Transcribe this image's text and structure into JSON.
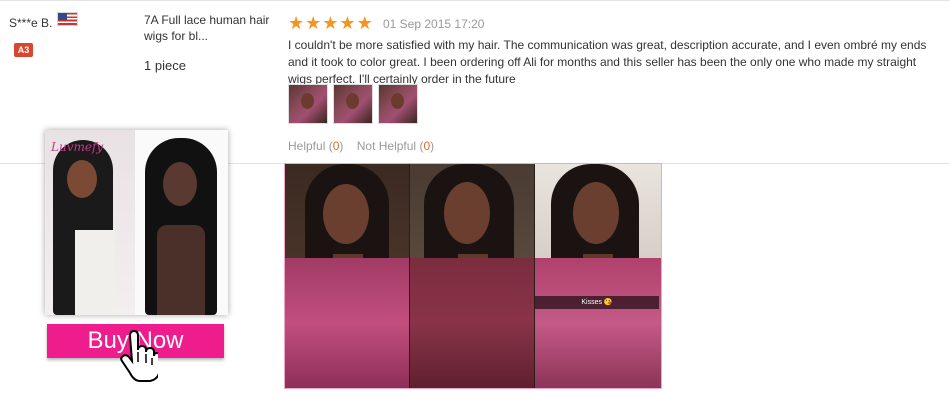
{
  "review": {
    "buyer_name": "S***e B.",
    "country_flag": "us-flag",
    "level_badge": "A3",
    "product_title": "7A Full lace human hair wigs for bl...",
    "quantity": "1 piece",
    "rating": 5,
    "date": "01 Sep 2015 17:20",
    "text": "I couldn't be more satisfied with my hair. The communication was great, description accurate, and I even ombré my ends and it took to color great. I been ordering off Ali for months and this seller has been the only one who made my straight wigs perfect. I'll certainly order in the future",
    "thumbnails": [
      "review-photo-1",
      "review-photo-2",
      "review-photo-3"
    ],
    "helpful_label": "Helpful",
    "helpful_count": "0",
    "not_helpful_label": "Not Helpful",
    "not_helpful_count": "0",
    "enlarged_caption": "Kisses 😘"
  },
  "ad": {
    "logo_text": "Luvmefy",
    "buy_label": "Buy Now"
  },
  "colors": {
    "star": "#f7941d",
    "buy_button": "#ef1c8e",
    "badge": "#d9452d",
    "count": "#e36a2a"
  }
}
